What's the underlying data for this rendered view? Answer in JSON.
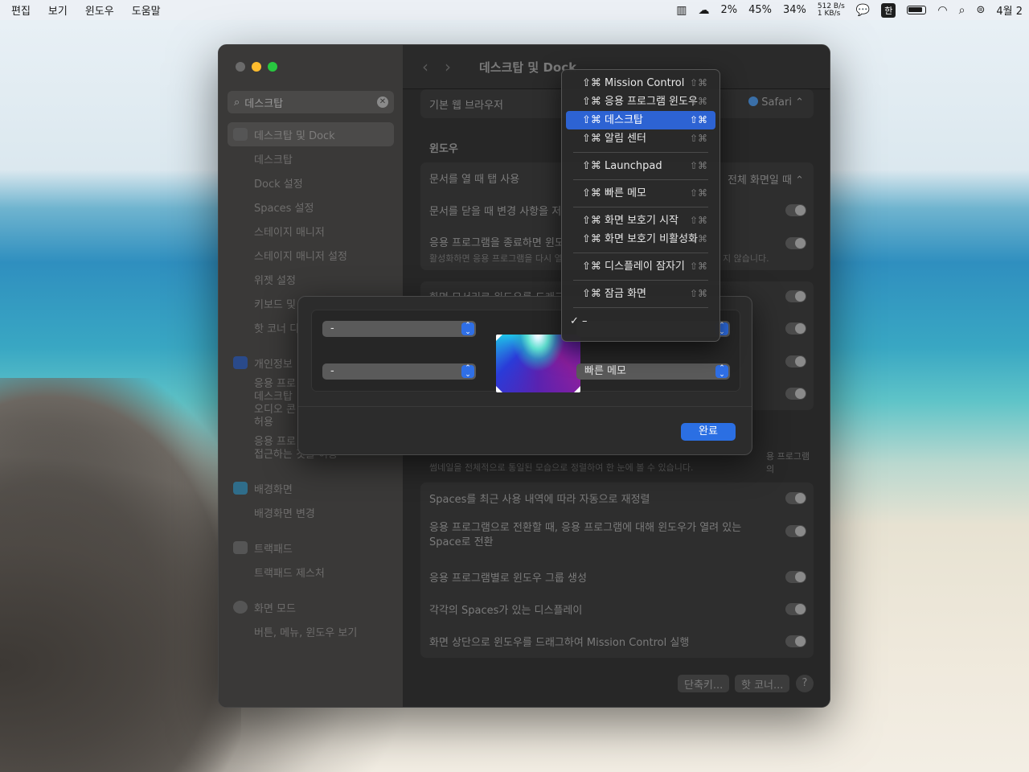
{
  "menubar": {
    "menus": [
      "편집",
      "보기",
      "윈도우",
      "도움말"
    ],
    "cpu": "2%",
    "mem": "45%",
    "disk": "34%",
    "net_up": "512 B/s",
    "net_down": "1 KB/s",
    "input_method": "한",
    "date": "4월 2"
  },
  "window": {
    "title": "데스크탑 및 Dock",
    "search_value": "데스크탑",
    "sidebar": [
      {
        "label": "데스크탑 및 Dock",
        "type": "head",
        "selected": true
      },
      {
        "label": "데스크탑"
      },
      {
        "label": "Dock 설정"
      },
      {
        "label": "Spaces 설정"
      },
      {
        "label": "스테이지 매니저"
      },
      {
        "label": "스테이지 매니저 설정"
      },
      {
        "label": "위젯 설정"
      },
      {
        "label": "키보드 및"
      },
      {
        "label": "핫 코너 디"
      },
      {
        "label": "개인정보",
        "type": "head"
      },
      {
        "label": "응용 프로"
      },
      {
        "label": "데스크탑"
      },
      {
        "label": "오디오 콘"
      },
      {
        "label": "허용"
      },
      {
        "label": "응용 프로"
      },
      {
        "label": "접근하는 것을 허용"
      },
      {
        "label": "배경화면",
        "type": "head"
      },
      {
        "label": "배경화면 변경"
      },
      {
        "label": "트랙패드",
        "type": "head"
      },
      {
        "label": "트랙패드 제스처"
      },
      {
        "label": "화면 모드",
        "type": "head"
      },
      {
        "label": "버튼, 메뉴, 윈도우 보기"
      }
    ],
    "rows": {
      "default_browser_label": "기본 웹 브라우저",
      "default_browser_value": "Safari",
      "windows_section": "윈도우",
      "tabs_label": "문서를 열 때 탭 사용",
      "tabs_value": "전체 화면일 때",
      "ask_save_label": "문서를 닫을 때 변경 사항을 저",
      "close_windows_label": "응용 프로그램을 종료하면 윈도",
      "close_windows_sub_left": "활성화하면 응용 프로그램을 다시 열",
      "close_windows_sub_right": "지 않습니다.",
      "drag_label": "화면 모서리로 윈도우를 드래그",
      "mission_sub_right": "용 프로그램의",
      "mission_sub": "썸네일을 전체적으로 통일된 모습으로 정렬하여 한 눈에 볼 수 있습니다.",
      "spaces_rearrange": "Spaces를 최근 사용 내역에 따라 자동으로 재정렬",
      "switch_space_1": "응용 프로그램으로 전환할 때, 응용 프로그램에 대해 윈도우가 열려 있는",
      "switch_space_2": "Space로 전환",
      "group_windows": "응용 프로그램별로 윈도우 그룹 생성",
      "separate_spaces": "각각의 Spaces가 있는 디스플레이",
      "drag_top": "화면 상단으로 윈도우를 드래그하여 Mission Control 실행"
    },
    "footer": {
      "shortcuts": "단축키...",
      "hot_corners": "핫 코너...",
      "help": "?"
    }
  },
  "sheet": {
    "top_left": "-",
    "bottom_left": "-",
    "bottom_right": "빠른 메모",
    "done": "완료"
  },
  "menu": {
    "items": [
      {
        "label": "⇧⌘ Mission Control",
        "shortcut": "⇧⌘"
      },
      {
        "label": "⇧⌘ 응용 프로그램 윈도우",
        "shortcut": "⇧⌘"
      },
      {
        "label": "⇧⌘ 데스크탑",
        "shortcut": "⇧⌘",
        "highlighted": true
      },
      {
        "label": "⇧⌘ 알림 센터",
        "shortcut": "⇧⌘"
      },
      {
        "sep": true
      },
      {
        "label": "⇧⌘ Launchpad",
        "shortcut": "⇧⌘"
      },
      {
        "sep": true
      },
      {
        "label": "⇧⌘ 빠른 메모",
        "shortcut": "⇧⌘"
      },
      {
        "sep": true
      },
      {
        "label": "⇧⌘ 화면 보호기 시작",
        "shortcut": "⇧⌘"
      },
      {
        "label": "⇧⌘ 화면 보호기 비활성화",
        "shortcut": "⇧⌘"
      },
      {
        "sep": true
      },
      {
        "label": "⇧⌘ 디스플레이 잠자기",
        "shortcut": "⇧⌘"
      },
      {
        "sep": true
      },
      {
        "label": "⇧⌘ 잠금 화면",
        "shortcut": "⇧⌘"
      },
      {
        "sep": true
      },
      {
        "label": "–",
        "checked": true
      }
    ]
  },
  "colors": {
    "accent": "#2d63d3",
    "close": "#ff5f57",
    "minimize": "#febc2e",
    "zoom": "#28c840"
  }
}
